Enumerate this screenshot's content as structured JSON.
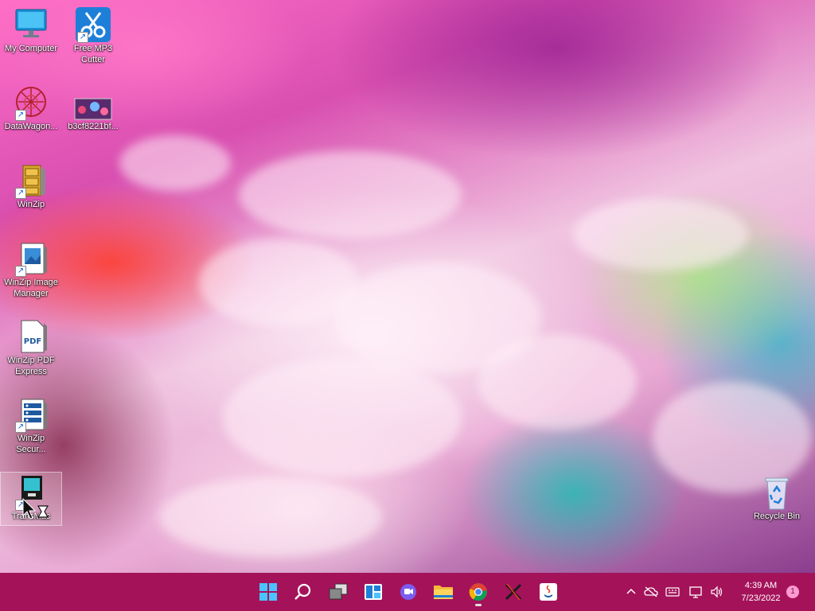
{
  "desktop": {
    "icons": [
      {
        "label": "My Computer",
        "icon": "monitor-icon"
      },
      {
        "label": "Free MP3\nCutter",
        "icon": "scissors-icon"
      },
      {
        "label": "DataWagon...",
        "icon": "datawagon-icon"
      },
      {
        "label": "b3cf8221bf...",
        "icon": "image-file-icon"
      },
      {
        "label": "WinZip",
        "icon": "winzip-cabinet-icon"
      },
      {
        "label": "WinZip Image\nManager",
        "icon": "winzip-image-icon"
      },
      {
        "label": "WinZip PDF\nExpress",
        "icon": "winzip-pdf-icon"
      },
      {
        "label": "WinZip\nSecur...",
        "icon": "winzip-secure-icon"
      },
      {
        "label": "TransMac",
        "icon": "transmac-icon"
      },
      {
        "label": "Recycle Bin",
        "icon": "recycle-bin-icon"
      }
    ],
    "pdf_badge": "PDF"
  },
  "taskbar": {
    "apps": [
      "start-icon",
      "search-icon",
      "task-view-icon",
      "widgets-icon",
      "chat-icon",
      "file-explorer-icon",
      "chrome-icon",
      "xmind-icon",
      "java-icon"
    ],
    "tray_icons": [
      "chevron-up-icon",
      "network-off-icon",
      "keyboard-icon",
      "display-icon",
      "volume-icon"
    ],
    "time": "4:39 AM",
    "date": "7/23/2022",
    "notification_count": "1",
    "colors": {
      "taskbar": "#a4135a"
    }
  }
}
